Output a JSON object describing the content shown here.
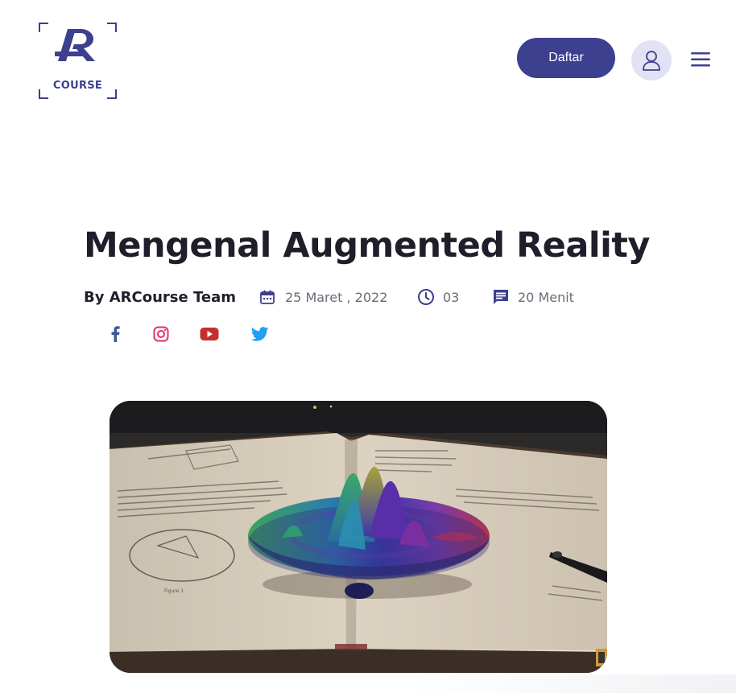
{
  "header": {
    "logo_text": "COURSE",
    "logo_letters": "AR",
    "register_label": "Daftar",
    "user_icon": "user-icon",
    "menu_icon": "hamburger-menu-icon"
  },
  "article": {
    "title": "Mengenal Augmented Reality",
    "author": "By ARCourse Team",
    "date": "25 Maret , 2022",
    "views": "03",
    "duration": "20 Menit",
    "icons": {
      "date": "calendar-icon",
      "views": "clock-icon",
      "duration": "comment-icon"
    }
  },
  "social": [
    {
      "name": "facebook",
      "icon": "facebook-icon",
      "color": "#3b5998"
    },
    {
      "name": "instagram",
      "icon": "instagram-icon",
      "color": "#e1306c"
    },
    {
      "name": "youtube",
      "icon": "youtube-icon",
      "color": "#c4302b"
    },
    {
      "name": "twitter",
      "icon": "twitter-icon",
      "color": "#1da1f2"
    }
  ],
  "hero_image": "book-with-augmented-3d-surface",
  "colors": {
    "brand": "#3d3f8f",
    "avatar_bg": "#e3e2f5",
    "title": "#1e1f2b",
    "meta_text": "#6b6b78"
  }
}
